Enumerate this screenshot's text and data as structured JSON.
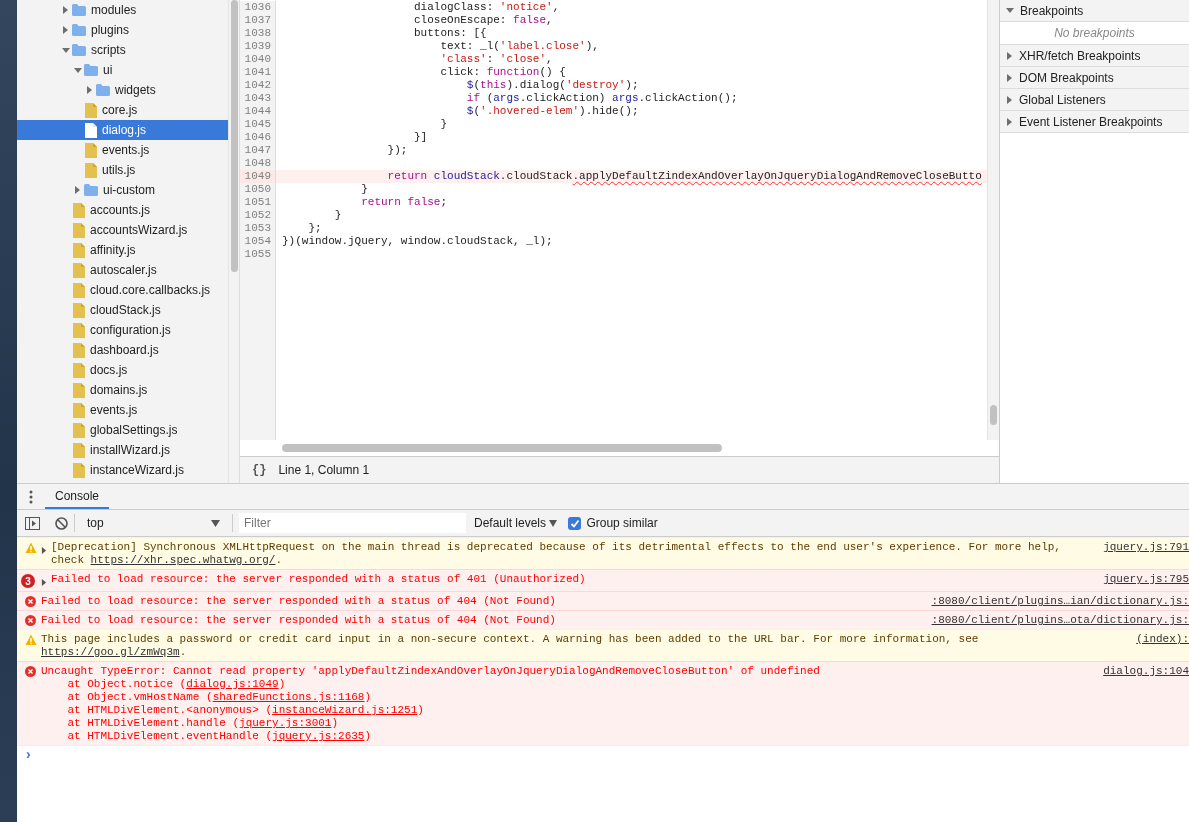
{
  "file_tree": [
    {
      "kind": "folder",
      "label": "modules",
      "expanded": false
    },
    {
      "kind": "folder",
      "label": "plugins",
      "expanded": false
    },
    {
      "kind": "folder",
      "label": "scripts",
      "expanded": true,
      "children": [
        {
          "kind": "folder",
          "label": "ui",
          "expanded": true,
          "children": [
            {
              "kind": "folder",
              "label": "widgets",
              "expanded": false
            },
            {
              "kind": "file",
              "label": "core.js",
              "selected": false
            },
            {
              "kind": "file",
              "label": "dialog.js",
              "selected": true
            },
            {
              "kind": "file",
              "label": "events.js",
              "selected": false
            },
            {
              "kind": "file",
              "label": "utils.js",
              "selected": false
            }
          ]
        },
        {
          "kind": "folder",
          "label": "ui-custom",
          "expanded": false
        },
        {
          "kind": "file",
          "label": "accounts.js",
          "selected": false
        },
        {
          "kind": "file",
          "label": "accountsWizard.js",
          "selected": false
        },
        {
          "kind": "file",
          "label": "affinity.js",
          "selected": false
        },
        {
          "kind": "file",
          "label": "autoscaler.js",
          "selected": false
        },
        {
          "kind": "file",
          "label": "cloud.core.callbacks.js",
          "selected": false
        },
        {
          "kind": "file",
          "label": "cloudStack.js",
          "selected": false
        },
        {
          "kind": "file",
          "label": "configuration.js",
          "selected": false
        },
        {
          "kind": "file",
          "label": "dashboard.js",
          "selected": false
        },
        {
          "kind": "file",
          "label": "docs.js",
          "selected": false
        },
        {
          "kind": "file",
          "label": "domains.js",
          "selected": false
        },
        {
          "kind": "file",
          "label": "events.js",
          "selected": false
        },
        {
          "kind": "file",
          "label": "globalSettings.js",
          "selected": false
        },
        {
          "kind": "file",
          "label": "installWizard.js",
          "selected": false
        },
        {
          "kind": "file",
          "label": "instanceWizard.js",
          "selected": false
        }
      ]
    }
  ],
  "editor": {
    "lines": [
      {
        "number": "1036",
        "segments": [
          {
            "kind": "plain",
            "text": "                    dialogClass: "
          },
          {
            "kind": "str",
            "text": "'notice'"
          },
          {
            "kind": "plain",
            "text": ","
          }
        ]
      },
      {
        "number": "1037",
        "segments": [
          {
            "kind": "plain",
            "text": "                    closeOnEscape: "
          },
          {
            "kind": "kw",
            "text": "false"
          },
          {
            "kind": "plain",
            "text": ","
          }
        ]
      },
      {
        "number": "1038",
        "segments": [
          {
            "kind": "plain",
            "text": "                    buttons: [{"
          }
        ]
      },
      {
        "number": "1039",
        "segments": [
          {
            "kind": "plain",
            "text": "                        text: _l("
          },
          {
            "kind": "str",
            "text": "'label.close'"
          },
          {
            "kind": "plain",
            "text": "),"
          }
        ]
      },
      {
        "number": "1040",
        "segments": [
          {
            "kind": "str",
            "text": "                        'class'"
          },
          {
            "kind": "plain",
            "text": ": "
          },
          {
            "kind": "str",
            "text": "'close'"
          },
          {
            "kind": "plain",
            "text": ","
          }
        ]
      },
      {
        "number": "1041",
        "segments": [
          {
            "kind": "plain",
            "text": "                        click: "
          },
          {
            "kind": "kw",
            "text": "function"
          },
          {
            "kind": "plain",
            "text": "() {"
          }
        ]
      },
      {
        "number": "1042",
        "segments": [
          {
            "kind": "var",
            "text": "                            $"
          },
          {
            "kind": "plain",
            "text": "("
          },
          {
            "kind": "kw",
            "text": "this"
          },
          {
            "kind": "plain",
            "text": ").dialog("
          },
          {
            "kind": "str",
            "text": "'destroy'"
          },
          {
            "kind": "plain",
            "text": ");"
          }
        ]
      },
      {
        "number": "1043",
        "segments": [
          {
            "kind": "kw",
            "text": "                            if"
          },
          {
            "kind": "plain",
            "text": " ("
          },
          {
            "kind": "var",
            "text": "args"
          },
          {
            "kind": "plain",
            "text": ".clickAction) "
          },
          {
            "kind": "var",
            "text": "args"
          },
          {
            "kind": "plain",
            "text": ".clickAction();"
          }
        ]
      },
      {
        "number": "1044",
        "segments": [
          {
            "kind": "var",
            "text": "                            $"
          },
          {
            "kind": "plain",
            "text": "("
          },
          {
            "kind": "str",
            "text": "'.hovered-elem'"
          },
          {
            "kind": "plain",
            "text": ").hide();"
          }
        ]
      },
      {
        "number": "1045",
        "segments": [
          {
            "kind": "plain",
            "text": "                        }"
          }
        ]
      },
      {
        "number": "1046",
        "segments": [
          {
            "kind": "plain",
            "text": "                    }]"
          }
        ]
      },
      {
        "number": "1047",
        "segments": [
          {
            "kind": "plain",
            "text": "                });"
          }
        ]
      },
      {
        "number": "1048"
      },
      {
        "number": "1049",
        "highlighted": true,
        "segments": [
          {
            "kind": "kw",
            "text": "                return"
          },
          {
            "kind": "var",
            "text": " cloudStack"
          },
          {
            "kind": "plain",
            "text": ".cloudStack"
          },
          {
            "kind": "err",
            "text": ".applyDefaultZindexAndOverlayOnJqueryDialogAndRemoveCloseButto"
          }
        ]
      },
      {
        "number": "1050",
        "segments": [
          {
            "kind": "plain",
            "text": "            }"
          }
        ]
      },
      {
        "number": "1051",
        "segments": [
          {
            "kind": "kw",
            "text": "            return"
          },
          {
            "kind": "kw",
            "text": " false"
          },
          {
            "kind": "plain",
            "text": ";"
          }
        ]
      },
      {
        "number": "1052",
        "segments": [
          {
            "kind": "plain",
            "text": "        }"
          }
        ]
      },
      {
        "number": "1053",
        "segments": [
          {
            "kind": "plain",
            "text": "    };"
          }
        ]
      },
      {
        "number": "1054",
        "segments": [
          {
            "kind": "plain",
            "text": "})(window.jQuery, window.cloudStack, _l);"
          }
        ]
      },
      {
        "number": "1055"
      }
    ],
    "pretty_print": "{}",
    "status": "Line 1, Column 1"
  },
  "breakpoint_sections": [
    {
      "label": "Breakpoints",
      "expanded": true,
      "empty_text": "No breakpoints"
    },
    {
      "label": "XHR/fetch Breakpoints",
      "expanded": false
    },
    {
      "label": "DOM Breakpoints",
      "expanded": false
    },
    {
      "label": "Global Listeners",
      "expanded": false
    },
    {
      "label": "Event Listener Breakpoints",
      "expanded": false
    }
  ],
  "drawer": {
    "tabs": [
      {
        "label": "Console",
        "selected": true
      }
    ]
  },
  "console_toolbar": {
    "context": "top",
    "filter_placeholder": "Filter",
    "levels": "Default levels",
    "group_similar": {
      "label": "Group similar",
      "checked": true
    }
  },
  "messages": [
    {
      "kind": "warning",
      "expanded": false,
      "text": "[Deprecation] Synchronous XMLHttpRequest on the main thread is deprecated because of its detrimental effects to the end user's experience. For more help, check ",
      "link": "https://xhr.spec.whatwg.org/",
      "after": ".",
      "source": "jquery.js:791"
    },
    {
      "kind": "error",
      "count": "3",
      "expanded": false,
      "text": "Failed to load resource: the server responded with a status of 401 (Unauthorized)",
      "source": "jquery.js:795"
    },
    {
      "kind": "error",
      "text": "Failed to load resource: the server responded with a status of 404 (Not Found)",
      "source": ":8080/client/plugins…ian/dictionary.js:"
    },
    {
      "kind": "error",
      "text": "Failed to load resource: the server responded with a status of 404 (Not Found)",
      "source": ":8080/client/plugins…ota/dictionary.js:"
    },
    {
      "kind": "warning",
      "text": "This page includes a password or credit card input in a non-secure context. A warning has been added to the URL bar. For more information, see ",
      "link": "https://goo.gl/zmWq3m",
      "after": ".",
      "source": "(index):"
    },
    {
      "kind": "error",
      "text": "Uncaught TypeError: Cannot read property 'applyDefaultZindexAndOverlayOnJqueryDialogAndRemoveCloseButton' of undefined",
      "source": "dialog.js:104",
      "stack": [
        {
          "text": "at Object.notice (",
          "link": "dialog.js:1049",
          "after": ")"
        },
        {
          "text": "at Object.vmHostName (",
          "link": "sharedFunctions.js:1168",
          "after": ")"
        },
        {
          "text": "at HTMLDivElement.<anonymous> (",
          "link": "instanceWizard.js:1251",
          "after": ")"
        },
        {
          "text": "at HTMLDivElement.handle (",
          "link": "jquery.js:3001",
          "after": ")"
        },
        {
          "text": "at HTMLDivElement.eventHandle (",
          "link": "jquery.js:2635",
          "after": ")"
        }
      ]
    }
  ],
  "prompt": "›"
}
